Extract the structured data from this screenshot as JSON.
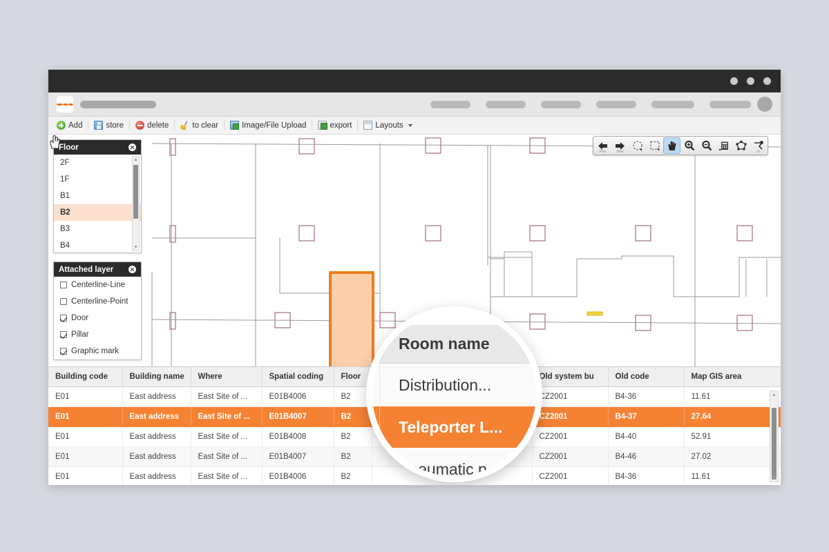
{
  "browser": {
    "window_dots": [
      "minimize",
      "maximize",
      "close"
    ],
    "favicon": "layers-icon",
    "tab_placeholders": 7,
    "avatar": "user-avatar"
  },
  "toolbar": {
    "items": [
      {
        "label": "Add",
        "icon": "add-circle-icon"
      },
      {
        "label": "store",
        "icon": "save-floppy-icon"
      },
      {
        "label": "delete",
        "icon": "delete-circle-icon"
      },
      {
        "label": "to clear",
        "icon": "broom-icon"
      },
      {
        "label": "Image/File Upload",
        "icon": "image-upload-icon"
      },
      {
        "label": "export",
        "icon": "export-icon"
      },
      {
        "label": "Layouts",
        "icon": "layouts-icon",
        "dropdown": true
      }
    ]
  },
  "floor_panel": {
    "title": "Floor",
    "close": "close-icon",
    "items": [
      {
        "label": "2F",
        "selected": false
      },
      {
        "label": "1F",
        "selected": false
      },
      {
        "label": "B1",
        "selected": false
      },
      {
        "label": "B2",
        "selected": true
      },
      {
        "label": "B3",
        "selected": false
      },
      {
        "label": "B4",
        "selected": false
      }
    ]
  },
  "layer_panel": {
    "title": "Attached layer",
    "close": "close-icon",
    "items": [
      {
        "label": "Centerline-Line",
        "checked": false
      },
      {
        "label": "Centerline-Point",
        "checked": false
      },
      {
        "label": "Door",
        "checked": true
      },
      {
        "label": "Pillar",
        "checked": true
      },
      {
        "label": "Graphic mark",
        "checked": true
      }
    ]
  },
  "map_toolbar": {
    "buttons": [
      {
        "name": "prev-icon",
        "label": "Prev",
        "active": false
      },
      {
        "name": "next-icon",
        "label": "Next",
        "active": false
      },
      {
        "name": "lasso-select-icon",
        "label": "",
        "active": false
      },
      {
        "name": "rect-select-icon",
        "label": "",
        "active": false
      },
      {
        "name": "pan-hand-icon",
        "label": "",
        "active": true
      },
      {
        "name": "zoom-in-icon",
        "label": "",
        "active": false
      },
      {
        "name": "zoom-out-icon",
        "label": "",
        "active": false
      },
      {
        "name": "calculator-icon",
        "label": "",
        "active": false
      },
      {
        "name": "topology-icon",
        "label": "",
        "active": false
      },
      {
        "name": "measure-icon",
        "label": "m",
        "active": false
      }
    ]
  },
  "map": {
    "selected_room_shape": "L-shape",
    "cursor": "pointing-hand-cursor",
    "colors": {
      "selection_fill": "#fccfab",
      "selection_stroke": "#ef7f1f",
      "pillar_stroke": "#b07f9a",
      "wall_stroke": "#9a9a9a",
      "door_mark": "#f2d23a"
    }
  },
  "table": {
    "columns": [
      "Building code",
      "Building name",
      "Where",
      "Spatial coding",
      "Floor",
      "Room name",
      "Old system bu",
      "Old code",
      "Map GIS area"
    ],
    "rows": [
      {
        "building_code": "E01",
        "building_name": "East address",
        "where": "East Site of ...",
        "spatial_coding": "E01B4006",
        "floor": "B2",
        "room_name": "Distribution...",
        "old_system_bu": "CZ2001",
        "old_code": "B4-36",
        "map_gis_area": "11.61",
        "selected": false
      },
      {
        "building_code": "E01",
        "building_name": "East address",
        "where": "East Site of ...",
        "spatial_coding": "E01B4007",
        "floor": "B2",
        "room_name": "Teleporter L...",
        "old_system_bu": "CZ2001",
        "old_code": "B4-37",
        "map_gis_area": "27.64",
        "selected": true
      },
      {
        "building_code": "E01",
        "building_name": "East address",
        "where": "East Site of ...",
        "spatial_coding": "E01B4008",
        "floor": "B2",
        "room_name": "Pneumatic p...",
        "old_system_bu": "CZ2001",
        "old_code": "B4-40",
        "map_gis_area": "52.91",
        "selected": false
      },
      {
        "building_code": "E01",
        "building_name": "East address",
        "where": "East Site of ...",
        "spatial_coding": "E01B4007",
        "floor": "B2",
        "room_name": "",
        "old_system_bu": "CZ2001",
        "old_code": "B4-46",
        "map_gis_area": "27.02",
        "selected": false
      },
      {
        "building_code": "E01",
        "building_name": "East address",
        "where": "East Site of ...",
        "spatial_coding": "E01B4006",
        "floor": "B2",
        "room_name": "",
        "old_system_bu": "CZ2001",
        "old_code": "B4-36",
        "map_gis_area": "11.61",
        "selected": false
      }
    ]
  },
  "magnifier": {
    "header": "Room name",
    "row1": "Distribution...",
    "row2": "Teleporter L...",
    "row3": "Pneumatic p..."
  }
}
